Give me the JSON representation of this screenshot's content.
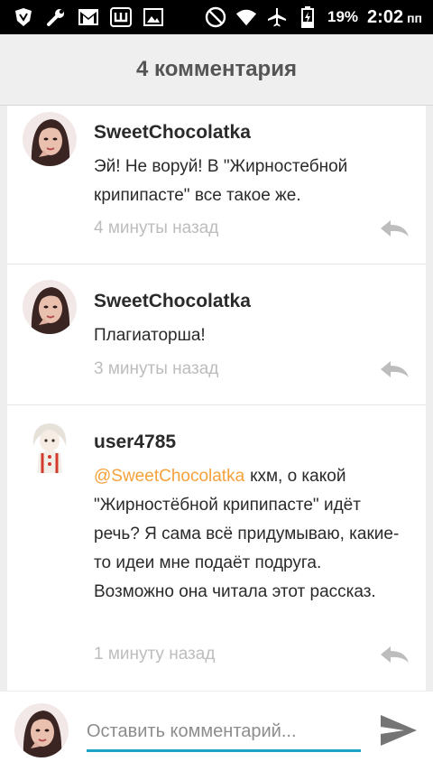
{
  "status_bar": {
    "battery": "19%",
    "time": "2:02",
    "ampm": "пп",
    "icons": [
      "shield-icon",
      "wrench-icon",
      "gmail-icon",
      "app-w-icon",
      "image-icon",
      "do-not-disturb-icon",
      "wifi-icon",
      "airplane-icon",
      "battery-charging-icon"
    ]
  },
  "header": {
    "title": "4 комментария"
  },
  "comments": [
    {
      "author": "SweetChocolatka",
      "text": "Эй! Не воруй! В \"Жирностебной крипипасте\" все такое же.",
      "time": "4 минуты назад",
      "avatar": "avatar-dark-hair-woman"
    },
    {
      "author": "SweetChocolatka",
      "text": "Плагиаторша!",
      "time": "3 минуты назад",
      "avatar": "avatar-dark-hair-woman"
    },
    {
      "author": "user4785",
      "mention": "@SweetChocolatka",
      "text": "кхм, о какой \"Жирностёбной крипипасте\" идёт речь? Я сама всё придумываю, какие-то идеи мне подаёт подруга. Возможно она читала этот рассказ.",
      "time": "1 минуту назад",
      "avatar": "avatar-anime-character"
    }
  ],
  "composer": {
    "placeholder": "Оставить комментарий...",
    "value": "",
    "send_icon": "send-icon"
  },
  "colors": {
    "accent": "#1fa3c4",
    "mention": "#f5a13a",
    "time_text": "#bdbdbd"
  }
}
